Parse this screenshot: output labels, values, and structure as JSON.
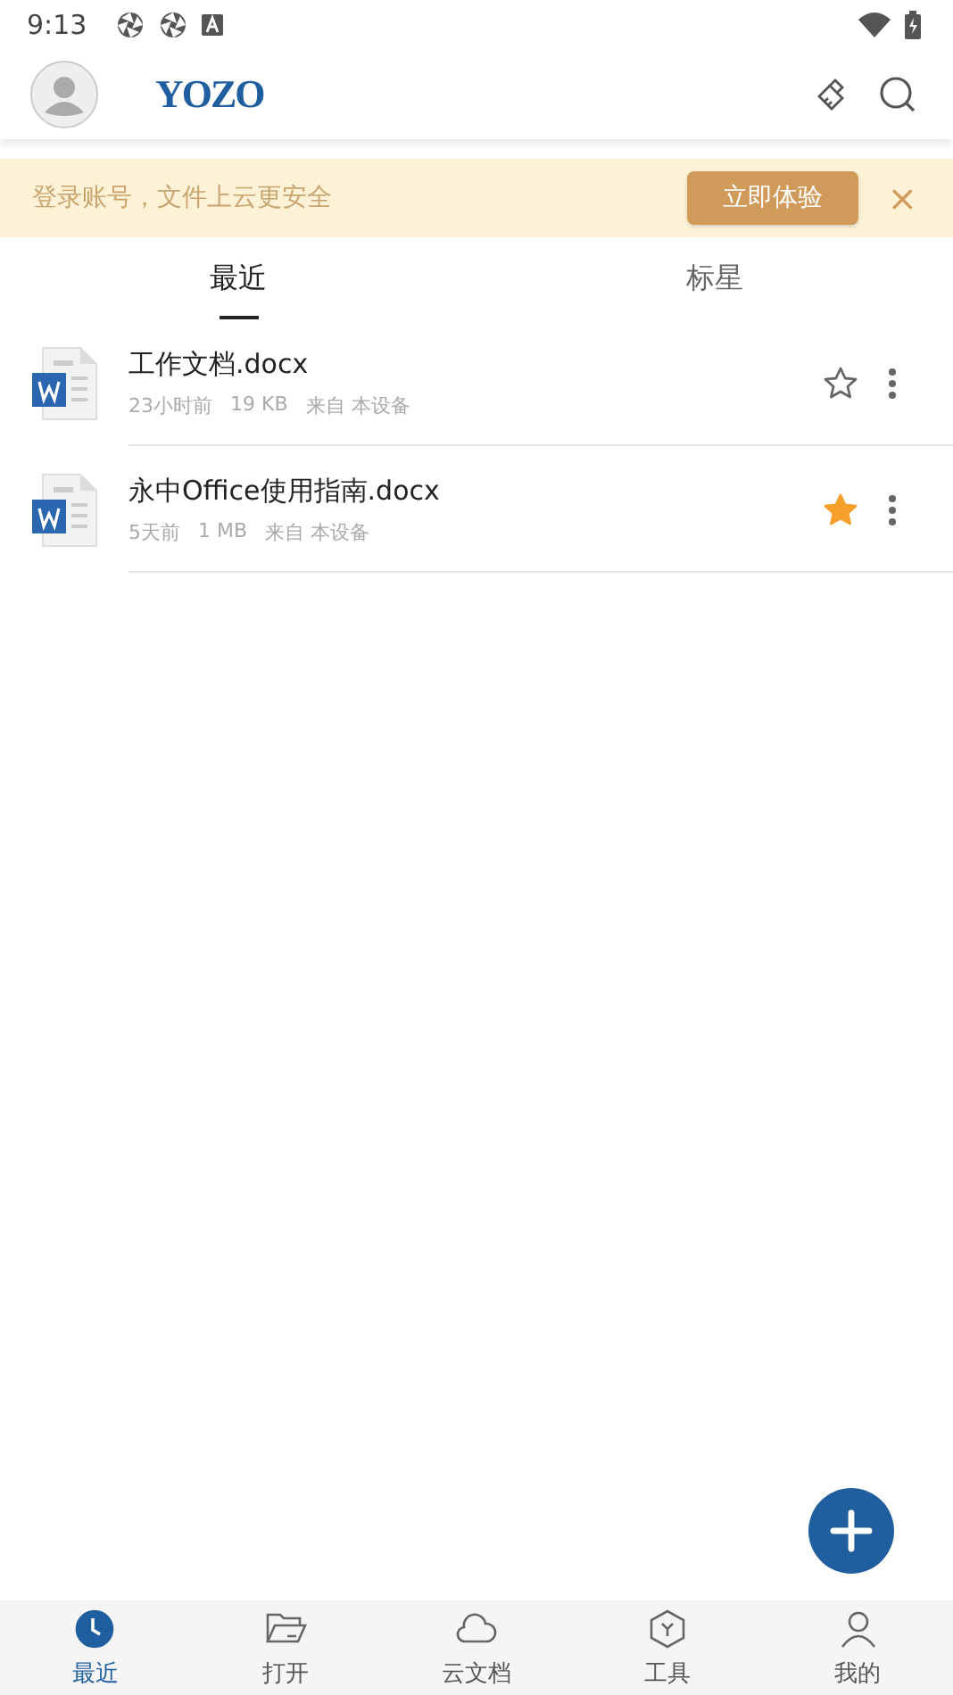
{
  "status_bar": {
    "time": "9:13"
  },
  "header": {
    "logo": "YOZO"
  },
  "banner": {
    "text": "登录账号，文件上云更安全",
    "button": "立即体验",
    "close": "×"
  },
  "tabs": [
    {
      "label": "最近",
      "selected": true
    },
    {
      "label": "标星",
      "selected": false
    }
  ],
  "files": [
    {
      "name": "工作文档.docx",
      "time": "23小时前",
      "size": "19 KB",
      "source": "来自 本设备",
      "starred": false
    },
    {
      "name": "永中Office使用指南.docx",
      "time": "5天前",
      "size": "1 MB",
      "source": "来自 本设备",
      "starred": true
    }
  ],
  "nav": [
    {
      "label": "最近",
      "kind": "recent",
      "selected": true
    },
    {
      "label": "打开",
      "kind": "open",
      "selected": false
    },
    {
      "label": "云文档",
      "kind": "cloud",
      "selected": false
    },
    {
      "label": "工具",
      "kind": "tools",
      "selected": false
    },
    {
      "label": "我的",
      "kind": "me",
      "selected": false
    }
  ]
}
